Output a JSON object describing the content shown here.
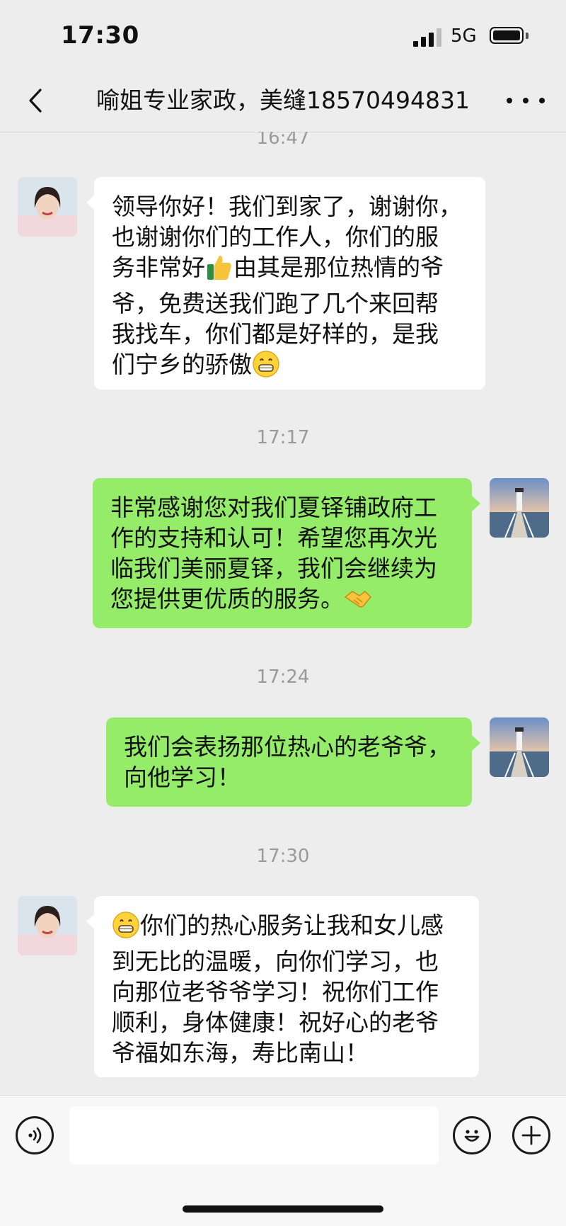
{
  "status_bar": {
    "time": "17:30",
    "network": "5G"
  },
  "header": {
    "title": "喻姐专业家政，美缝18570494831"
  },
  "messages": [
    {
      "time": "16:47"
    },
    {
      "from": "them",
      "lines": [
        "领导你好！我们到家了，谢谢你，",
        "也谢谢你们的工作人，你们的服",
        "务非常好",
        "由其是那位热情的爷",
        "爷，免费送我们跑了几个来回帮",
        "我找车，你们都是好样的，是我",
        "们宁乡的骄傲"
      ],
      "emojis": [
        "thumbs-up",
        "grinning-face"
      ]
    },
    {
      "time": "17:17"
    },
    {
      "from": "me",
      "lines": [
        "非常感谢您对我们夏铎铺政府工",
        "作的支持和认可！希望您再次光",
        "临我们美丽夏铎，我们会继续为",
        "您提供更优质的服务。"
      ],
      "emojis": [
        "handshake"
      ]
    },
    {
      "time": "17:24"
    },
    {
      "from": "me",
      "lines": [
        "我们会表扬那位热心的老爷爷，",
        "向他学习！"
      ]
    },
    {
      "time": "17:30"
    },
    {
      "from": "them",
      "lines": [
        "你们的热心服务让我和女儿感",
        "到无比的温暖，向你们学习，也",
        "向那位老爷爷学习！祝你们工作",
        "顺利，身体健康！祝好心的老爷",
        "爷福如东海，寿比南山！"
      ],
      "emojis": [
        "grinning-face"
      ]
    }
  ],
  "input": {
    "placeholder": ""
  },
  "icons": {
    "back": "chevron-left-icon",
    "more": "more-dots-icon",
    "voice": "voice-icon",
    "emoji": "emoji-icon",
    "add": "plus-icon"
  },
  "colors": {
    "outgoing_bubble": "#95ec69",
    "incoming_bubble": "#ffffff",
    "background": "#ededed"
  }
}
